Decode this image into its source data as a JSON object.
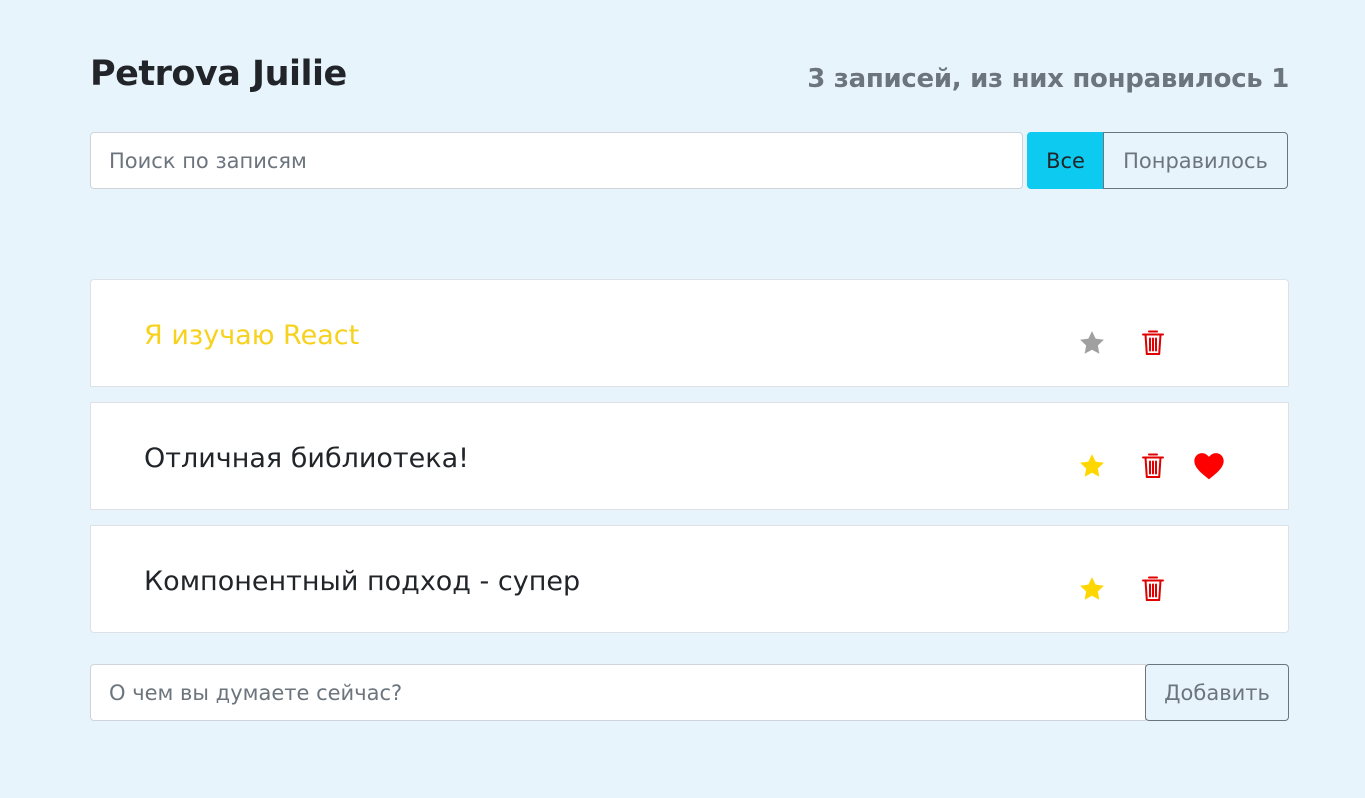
{
  "header": {
    "title": "Petrova Juilie",
    "summary": "3 записей, из них понравилось 1"
  },
  "search": {
    "placeholder": "Поиск по записям",
    "value": ""
  },
  "filters": [
    {
      "label": "Все",
      "active": true
    },
    {
      "label": "Понравилось",
      "active": false
    }
  ],
  "posts": [
    {
      "label": "Я изучаю React",
      "important": true,
      "liked": false
    },
    {
      "label": "Отличная библиотека!",
      "important": false,
      "liked": true
    },
    {
      "label": "Компонентный подход - супер",
      "important": false,
      "liked": false
    }
  ],
  "add_form": {
    "placeholder": "О чем вы думаете сейчас?",
    "value": "",
    "button_label": "Добавить"
  },
  "icons": {
    "star": "star-icon",
    "trash": "trash-icon",
    "heart": "heart-icon"
  },
  "colors": {
    "background": "#e8f4fc",
    "accent_button": "#0dcaf0",
    "important_text": "#f7d21c",
    "star_active": "#ffd700",
    "star_inactive": "#a0a0a0",
    "trash": "#e00000",
    "heart": "#ff0000",
    "muted": "#6c757d"
  }
}
